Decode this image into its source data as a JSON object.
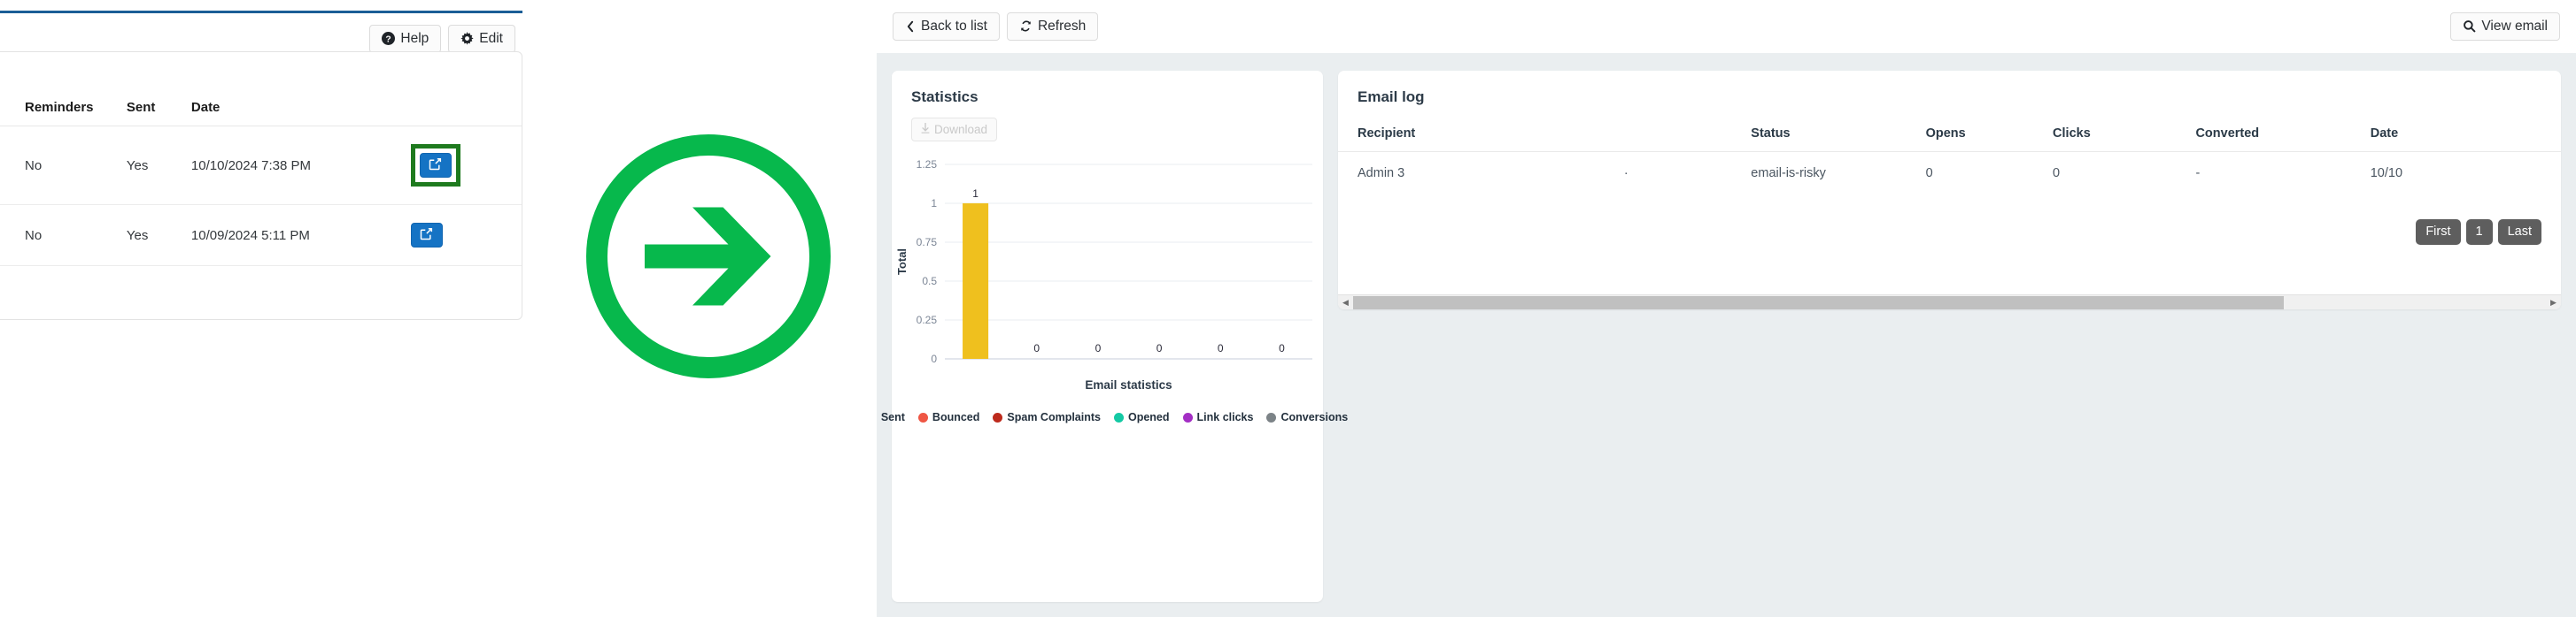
{
  "left_panel": {
    "toolbar": [
      {
        "label": "Help",
        "icon": "question-circle-icon"
      },
      {
        "label": "Edit",
        "icon": "gear-icon"
      }
    ],
    "table": {
      "columns": [
        "Reminders",
        "Sent",
        "Date"
      ],
      "rows": [
        {
          "reminders": "No",
          "sent": "Yes",
          "date": "10/10/2024 7:38 PM",
          "action_icon": "external-link-edit-icon",
          "highlighted": true
        },
        {
          "reminders": "No",
          "sent": "Yes",
          "date": "10/09/2024 5:11 PM",
          "action_icon": "external-link-edit-icon",
          "highlighted": false
        }
      ]
    },
    "highlight_color": "#1e7a1e",
    "accent_rule_color": "#1b5e96"
  },
  "annotation": {
    "icon": "arrow-right-circle-icon",
    "color": "#07b84c"
  },
  "right_panel": {
    "toolbar_left": [
      {
        "label": "Back to list",
        "icon": "chevron-left-icon"
      },
      {
        "label": "Refresh",
        "icon": "refresh-icon"
      }
    ],
    "toolbar_right": [
      {
        "label": "View email",
        "icon": "search-icon"
      }
    ],
    "statistics": {
      "title": "Statistics",
      "download_label": "Download",
      "download_icon": "download-icon"
    },
    "email_log": {
      "title": "Email log",
      "columns": [
        "Recipient",
        "",
        "Status",
        "Opens",
        "Clicks",
        "Converted",
        "Date"
      ],
      "rows": [
        {
          "recipient": "Admin 3",
          "email": "·",
          "status": "email-is-risky",
          "opens": "0",
          "clicks": "0",
          "converted": "-",
          "date": "10/10"
        }
      ],
      "pagination": [
        "First",
        "1",
        "Last"
      ],
      "scroll_left_icon": "triangle-left-icon",
      "scroll_right_icon": "triangle-right-icon"
    }
  },
  "chart_data": {
    "type": "bar",
    "title": "",
    "xlabel": "Email statistics",
    "ylabel": "Total",
    "categories": [
      "Sent",
      "Bounced",
      "Spam Complaints",
      "Opened",
      "Link clicks",
      "Conversions"
    ],
    "values": [
      1,
      0,
      0,
      0,
      0,
      0
    ],
    "data_labels": [
      "1",
      "0",
      "0",
      "0",
      "0",
      "0"
    ],
    "colors": [
      "#efc01e",
      "#ef5644",
      "#bd2a1c",
      "#14c9a4",
      "#a32ec4",
      "#7c8387"
    ],
    "ylim": [
      0,
      1.25
    ],
    "yticks": [
      "0",
      "0.25",
      "0.5",
      "0.75",
      "1",
      "1.25"
    ],
    "ytick_values": [
      0,
      0.25,
      0.5,
      0.75,
      1,
      1.25
    ],
    "grid": true,
    "legend_position": "bottom",
    "legend": [
      "Sent",
      "Bounced",
      "Spam Complaints",
      "Opened",
      "Link clicks",
      "Conversions"
    ]
  }
}
